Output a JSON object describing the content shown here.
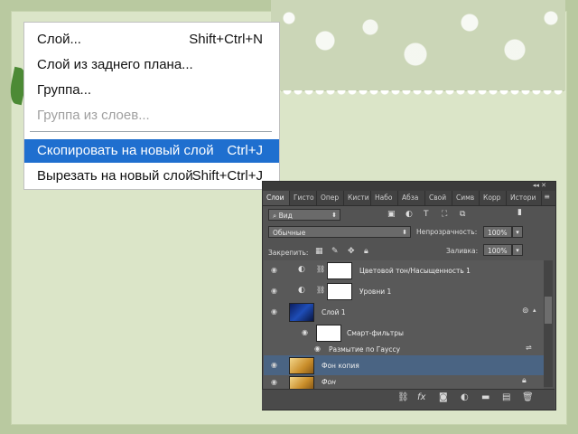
{
  "menu": {
    "items": [
      {
        "label": "Слой...",
        "shortcut": "Shift+Ctrl+N"
      },
      {
        "label": "Слой из заднего плана...",
        "shortcut": ""
      },
      {
        "label": "Группа...",
        "shortcut": ""
      },
      {
        "label": "Группа из слоев...",
        "shortcut": "",
        "disabled": true
      },
      {
        "label": "Скопировать на новый слой",
        "shortcut": "Ctrl+J",
        "selected": true
      },
      {
        "label": "Вырезать на новый слой",
        "shortcut": "Shift+Ctrl+J"
      }
    ]
  },
  "panel": {
    "tabs": [
      "Слои",
      "Гисто",
      "Опер",
      "Кисти",
      "Набо",
      "Абза",
      "Свой",
      "Симв",
      "Корр",
      "Истори"
    ],
    "filter_label": "Вид",
    "blend_mode": "Обычные",
    "opacity_label": "Непрозрачность:",
    "opacity_value": "100%",
    "lock_label": "Закрепить:",
    "fill_label": "Заливка:",
    "fill_value": "100%",
    "layers": [
      {
        "name": "Цветовой тон/Насыщенность 1"
      },
      {
        "name": "Уровни 1"
      },
      {
        "name": "Слой 1"
      },
      {
        "name": "Смарт-фильтры"
      },
      {
        "name": "Размытие по Гауссу"
      },
      {
        "name": "Фон копия",
        "selected": true
      },
      {
        "name": "Фон"
      }
    ],
    "bottom_icons": [
      "link-icon",
      "fx-icon",
      "mask-icon",
      "adjustment-icon",
      "folder-icon",
      "new-layer-icon",
      "trash-icon"
    ],
    "fx_label": "fx"
  },
  "colors": {
    "menu_highlight": "#1f6fcf",
    "panel_bg": "#535353",
    "selected_layer": "#4a6483",
    "slide_bg": "#dbe5c8"
  }
}
